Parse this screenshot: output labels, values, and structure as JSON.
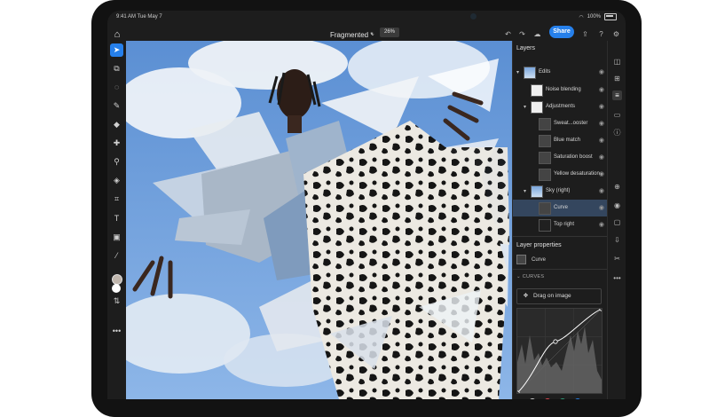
{
  "status_bar": {
    "time": "9:41 AM Tue May 7",
    "battery": "100%"
  },
  "topbar": {
    "doc_title": "Fragmented *",
    "zoom": "26%",
    "share_label": "Share"
  },
  "icons": {
    "home": "home-icon",
    "undo": "undo-icon",
    "redo": "redo-icon",
    "cloud": "cloud-icon",
    "export": "export-icon",
    "help": "help-icon",
    "settings": "gear-icon"
  },
  "tools": [
    "move-tool",
    "transform-tool",
    "lasso-tool",
    "brush-tool",
    "eraser-tool",
    "healing-tool",
    "clone-tool",
    "fill-tool",
    "crop-tool",
    "type-tool",
    "place-image-tool",
    "eyedropper-tool",
    "swap-colors-tool",
    "more-tools"
  ],
  "layers_panel": {
    "title": "Layers",
    "layers": [
      {
        "name": "Edits",
        "level": 0,
        "chev": "▾",
        "thumb": "sky"
      },
      {
        "name": "Noise blending",
        "level": 1,
        "chev": "",
        "thumb": "light"
      },
      {
        "name": "Adjustments",
        "level": 1,
        "chev": "▾",
        "thumb": "light"
      },
      {
        "name": "Sweat...ooster",
        "level": 2,
        "chev": "",
        "thumb": "adj"
      },
      {
        "name": "Blue match",
        "level": 2,
        "chev": "",
        "thumb": "adj"
      },
      {
        "name": "Saturation boost",
        "level": 2,
        "chev": "",
        "thumb": "adj"
      },
      {
        "name": "Yellow desaturation",
        "level": 2,
        "chev": "",
        "thumb": "adj"
      },
      {
        "name": "Sky (right)",
        "level": 1,
        "chev": "▾",
        "thumb": "sky"
      },
      {
        "name": "Curve",
        "level": 2,
        "chev": "",
        "thumb": "adj",
        "selected": true
      },
      {
        "name": "Top right",
        "level": 2,
        "chev": "",
        "thumb": "dark"
      }
    ]
  },
  "layer_properties": {
    "title": "Layer properties",
    "layer_name": "Curve"
  },
  "curves": {
    "section_label": "CURVES",
    "drag_label": "Drag on image",
    "channels": [
      {
        "name": "rgb",
        "color": "#cfcfcf"
      },
      {
        "name": "red",
        "color": "#e34850"
      },
      {
        "name": "green",
        "color": "#2d9d78"
      },
      {
        "name": "blue",
        "color": "#2680eb"
      }
    ]
  },
  "right_rail": [
    "layers-icon",
    "add-layer-icon",
    "adjustments-icon",
    "comments-icon",
    "info-icon",
    "add-icon",
    "visibility-icon",
    "mask-icon",
    "download-icon",
    "delete-icon",
    "more-icon"
  ],
  "colors": {
    "accent": "#2680eb",
    "panel_bg": "#1d1d1d",
    "selected_row": "#34465e"
  }
}
